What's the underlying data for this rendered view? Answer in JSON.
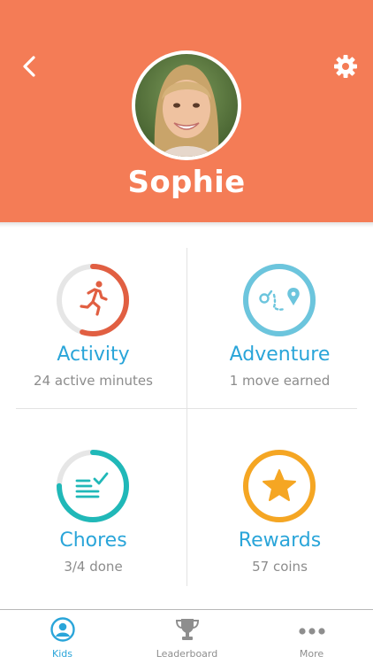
{
  "profile": {
    "name": "Sophie"
  },
  "tiles": [
    {
      "title": "Activity",
      "subtitle": "24 active minutes",
      "progress": 0.55,
      "color": "#e15f42"
    },
    {
      "title": "Adventure",
      "subtitle": "1 move earned",
      "progress": 1.0,
      "color": "#6cc5dd"
    },
    {
      "title": "Chores",
      "subtitle": "3/4 done",
      "progress": 0.75,
      "color": "#20b8b8"
    },
    {
      "title": "Rewards",
      "subtitle": "57 coins",
      "progress": 1.0,
      "color": "#f5a623"
    }
  ],
  "tabs": [
    {
      "label": "Kids",
      "icon": "kid-profile-icon",
      "active": true
    },
    {
      "label": "Leaderboard",
      "icon": "trophy-icon",
      "active": false
    },
    {
      "label": "More",
      "icon": "more-dots-icon",
      "active": false
    }
  ],
  "colors": {
    "header": "#f47c56",
    "accent": "#2aa5d9",
    "track": "#e6e6e6"
  }
}
